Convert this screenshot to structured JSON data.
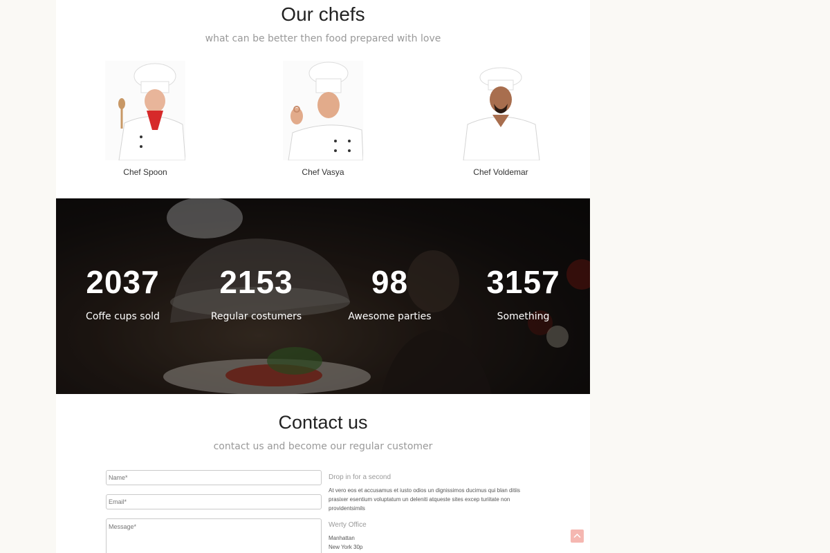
{
  "chefs": {
    "title": "Our chefs",
    "subtitle": "what can be better then food prepared with love",
    "items": [
      {
        "name": "Chef Spoon"
      },
      {
        "name": "Chef Vasya"
      },
      {
        "name": "Chef Voldemar"
      }
    ]
  },
  "stats": {
    "items": [
      {
        "value": "2037",
        "label": "Coffe cups sold"
      },
      {
        "value": "2153",
        "label": "Regular costumers"
      },
      {
        "value": "98",
        "label": "Awesome parties"
      },
      {
        "value": "3157",
        "label": "Something"
      }
    ]
  },
  "contact": {
    "title": "Contact us",
    "subtitle": "contact us and become our regular customer",
    "form": {
      "name_placeholder": "Name*",
      "email_placeholder": "Email*",
      "message_placeholder": "Message*"
    },
    "info": {
      "drop_heading": "Drop in for a second",
      "drop_text": "At vero eos et accusamus et iusto odios un dignissimos ducimus qui blan ditiis prasixer esentium voluptatum un deleniti atqueste sites excep turiitate non providentsimils",
      "office_heading": "Werty Office",
      "office_line1": "Manhattan",
      "office_line2": "New York 30p"
    }
  },
  "colors": {
    "page_bg": "#faf9f5",
    "content_bg": "#ffffff",
    "scroll_top_button": "#f5b7b1"
  },
  "icons": {
    "scroll_top": "chevron-up-icon"
  }
}
